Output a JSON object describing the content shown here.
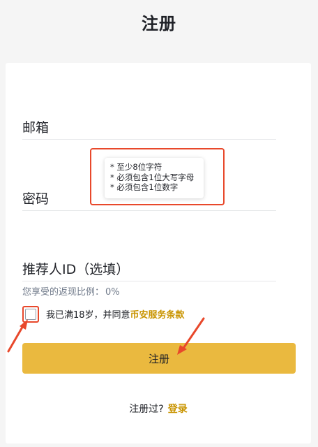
{
  "header": {
    "title": "注册"
  },
  "form": {
    "email_label": "邮箱",
    "password_label": "密码",
    "password_hints": [
      "* 至少8位字符",
      "* 必须包含1位大写字母",
      "* 必须包含1位数字"
    ],
    "referral_label": "推荐人ID（选填）",
    "rebate_label": "您享受的返现比例：",
    "rebate_value": "0%",
    "agree_text": "我已满18岁，并同意",
    "terms_link": "币安服务条款",
    "register_button": "注册"
  },
  "footer": {
    "already_registered": "注册过?",
    "login_link": "登录"
  },
  "colors": {
    "accent": "#eab93f",
    "link": "#c99400",
    "annotation": "#e8482b"
  }
}
